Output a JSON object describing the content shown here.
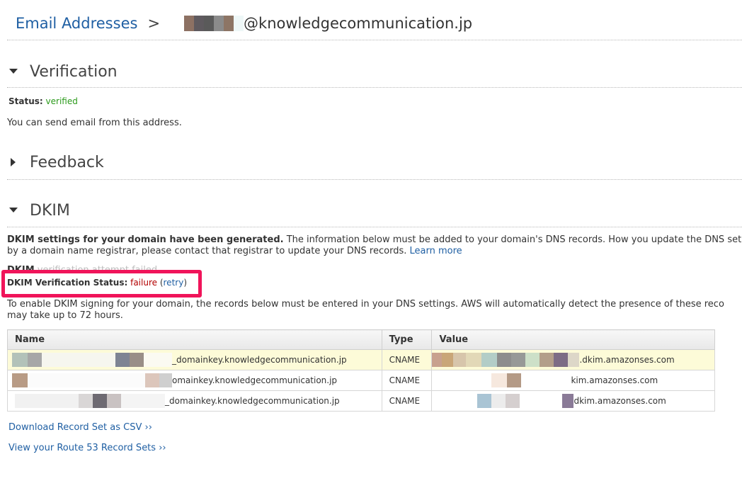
{
  "breadcrumb": {
    "parent": "Email Addresses",
    "separator": ">",
    "address_domain": "@knowledgecommunication.jp",
    "redaction_colors": [
      "#8d7163",
      "#5f5a5f",
      "#5a5a5a",
      "#8b8b8b",
      "#8d7565",
      "#eef7f7"
    ]
  },
  "verification": {
    "title": "Verification",
    "status_label": "Status:",
    "status_value": "verified",
    "message": "You can send email from this address."
  },
  "feedback": {
    "title": "Feedback"
  },
  "dkim": {
    "title": "DKIM",
    "intro_bold": "DKIM settings for your domain have been generated.",
    "intro_text": " The information below must be added to your domain's DNS records. How you update the DNS set",
    "intro_line2": "by a domain name registrar, please contact that registrar to update your DNS records. ",
    "learn_more": "Learn more",
    "obscured_label": "DKIM",
    "obscured_text": "verification attempt failed",
    "verification_status_label": "DKIM Verification Status:",
    "verification_status_value": "failure",
    "retry_open": "(",
    "retry_label": "retry",
    "retry_close": ")",
    "instructions_line1": "To enable DKIM signing for your domain, the records below must be entered in your DNS settings. AWS will automatically detect the presence of these reco",
    "instructions_line2": "may take up to 72 hours."
  },
  "records_table": {
    "columns": [
      "Name",
      "Type",
      "Value"
    ],
    "rows": [
      {
        "name_suffix": "_domainkey.knowledgecommunication.jp",
        "type": "CNAME",
        "value_suffix": ".dkim.amazonses.com"
      },
      {
        "name_suffix": "omainkey.knowledgecommunication.jp",
        "type": "CNAME",
        "value_suffix": "kim.amazonses.com"
      },
      {
        "name_suffix": "_domainkey.knowledgecommunication.jp",
        "type": "CNAME",
        "value_suffix": "dkim.amazonses.com"
      }
    ]
  },
  "links": {
    "download_csv": "Download Record Set as CSV ››",
    "route53": "View your Route 53 Record Sets ››"
  },
  "colors": {
    "link": "#1f5fa3",
    "verified": "#2b9a1b",
    "failure": "#b30000",
    "highlight": "#f0145a",
    "selected_row": "#fdfbd8"
  },
  "icons": {
    "section_expanded": "caret-down-icon",
    "section_collapsed": "caret-right-icon"
  }
}
